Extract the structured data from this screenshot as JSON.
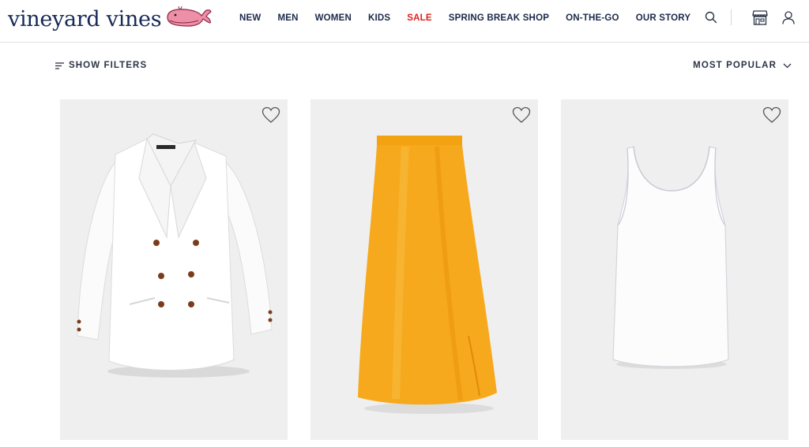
{
  "brand": {
    "name": "vineyard vines",
    "logo_color": "#162a57",
    "whale_color": "#ee8fa8"
  },
  "nav": {
    "items": [
      {
        "label": "NEW",
        "sale": false
      },
      {
        "label": "MEN",
        "sale": false
      },
      {
        "label": "WOMEN",
        "sale": false
      },
      {
        "label": "KIDS",
        "sale": false
      },
      {
        "label": "SALE",
        "sale": true
      },
      {
        "label": "SPRING BREAK SHOP",
        "sale": false
      },
      {
        "label": "ON-THE-GO",
        "sale": false
      },
      {
        "label": "OUR STORY",
        "sale": false
      }
    ],
    "sale_color": "#e2211c",
    "text_color": "#1b2a4a"
  },
  "header_icons": [
    "search-icon",
    "store-icon",
    "account-icon"
  ],
  "toolbar": {
    "filters_label": "SHOW FILTERS",
    "filters_icon": "filter-lines-icon",
    "sort_label": "MOST POPULAR",
    "sort_icon": "chevron-down-icon"
  },
  "products": [
    {
      "item": "white double-breasted blazer",
      "image_bg": "#efefef",
      "icon": "heart-outline-icon"
    },
    {
      "item": "orange satin midi skirt",
      "image_bg": "#efefef",
      "icon": "heart-outline-icon"
    },
    {
      "item": "white tank top",
      "image_bg": "#efefef",
      "icon": "heart-outline-icon"
    }
  ]
}
